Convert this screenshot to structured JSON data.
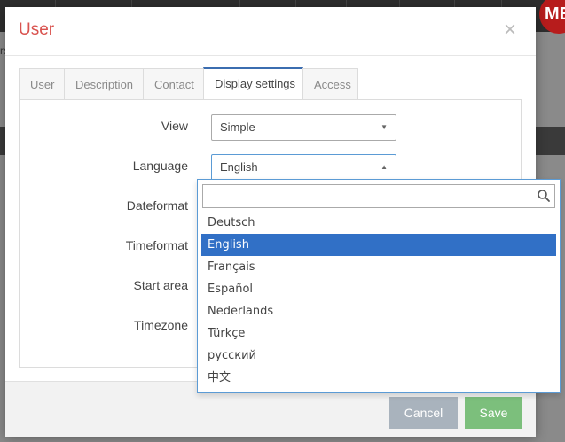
{
  "background": {
    "left_text": "rs",
    "avatar_text": "ME"
  },
  "modal": {
    "title": "User",
    "close_symbol": "×",
    "tabs": [
      {
        "label": "User",
        "active": false
      },
      {
        "label": "Description",
        "active": false
      },
      {
        "label": "Contact",
        "active": false
      },
      {
        "label": "Display settings",
        "active": true
      },
      {
        "label": "Access",
        "active": false
      }
    ],
    "fields": {
      "view": {
        "label": "View",
        "value": "Simple"
      },
      "language": {
        "label": "Language",
        "value": "English"
      },
      "dateformat": {
        "label": "Dateformat"
      },
      "timeformat": {
        "label": "Timeformat"
      },
      "start_area": {
        "label": "Start area"
      },
      "timezone": {
        "label": "Timezone"
      }
    },
    "footer": {
      "cancel_label": "Cancel",
      "save_label": "Save"
    }
  },
  "language_dropdown": {
    "search_value": "",
    "search_icon": "search-icon",
    "options": [
      "Deutsch",
      "English",
      "Français",
      "Español",
      "Nederlands",
      "Türkçe",
      "русский",
      "中文"
    ],
    "selected": "English"
  },
  "colors": {
    "title_red": "#d9534f",
    "active_tab_accent": "#3b6db0",
    "selected_option_bg": "#3170c6",
    "cancel_bg": "#a9b3bd",
    "save_bg": "#7cbf7c"
  }
}
